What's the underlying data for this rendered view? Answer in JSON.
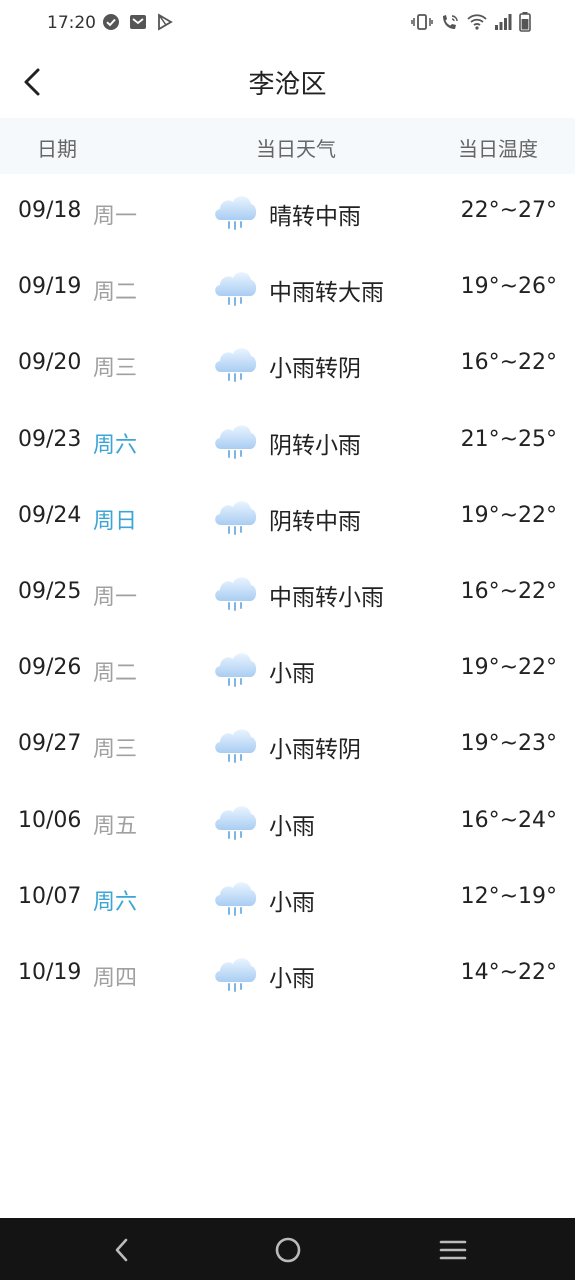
{
  "status": {
    "time": "17:20",
    "icons_left": [
      "check-circle-icon",
      "mail-icon",
      "play-store-icon"
    ],
    "icons_right": [
      "vibrate-icon",
      "wifi-call-icon",
      "wifi-icon",
      "signal-icon",
      "battery-icon"
    ]
  },
  "header": {
    "title": "李沧区",
    "back_icon": "chevron-left-icon"
  },
  "columns": {
    "date": "日期",
    "weather": "当日天气",
    "temp": "当日温度"
  },
  "colors": {
    "weekend": "#3ba5d6",
    "weekday": "#a0a0a0",
    "header_bg": "#f5f9fc",
    "navbar_bg": "#141414"
  },
  "rows": [
    {
      "date": "09/18",
      "weekday": "周一",
      "weekend": false,
      "icon": "rain-cloud-icon",
      "desc": "晴转中雨",
      "temp": "22°~27°"
    },
    {
      "date": "09/19",
      "weekday": "周二",
      "weekend": false,
      "icon": "rain-cloud-icon",
      "desc": "中雨转大雨",
      "temp": "19°~26°"
    },
    {
      "date": "09/20",
      "weekday": "周三",
      "weekend": false,
      "icon": "rain-cloud-icon",
      "desc": "小雨转阴",
      "temp": "16°~22°"
    },
    {
      "date": "09/23",
      "weekday": "周六",
      "weekend": true,
      "icon": "rain-cloud-icon",
      "desc": "阴转小雨",
      "temp": "21°~25°"
    },
    {
      "date": "09/24",
      "weekday": "周日",
      "weekend": true,
      "icon": "rain-cloud-icon",
      "desc": "阴转中雨",
      "temp": "19°~22°"
    },
    {
      "date": "09/25",
      "weekday": "周一",
      "weekend": false,
      "icon": "rain-cloud-icon",
      "desc": "中雨转小雨",
      "temp": "16°~22°"
    },
    {
      "date": "09/26",
      "weekday": "周二",
      "weekend": false,
      "icon": "rain-cloud-icon",
      "desc": "小雨",
      "temp": "19°~22°"
    },
    {
      "date": "09/27",
      "weekday": "周三",
      "weekend": false,
      "icon": "rain-cloud-icon",
      "desc": "小雨转阴",
      "temp": "19°~23°"
    },
    {
      "date": "10/06",
      "weekday": "周五",
      "weekend": false,
      "icon": "rain-cloud-icon",
      "desc": "小雨",
      "temp": "16°~24°"
    },
    {
      "date": "10/07",
      "weekday": "周六",
      "weekend": true,
      "icon": "rain-cloud-icon",
      "desc": "小雨",
      "temp": "12°~19°"
    },
    {
      "date": "10/19",
      "weekday": "周四",
      "weekend": false,
      "icon": "rain-cloud-icon",
      "desc": "小雨",
      "temp": "14°~22°"
    }
  ],
  "navbar": {
    "icons": [
      "back-triangle-icon",
      "home-circle-icon",
      "menu-lines-icon"
    ]
  }
}
